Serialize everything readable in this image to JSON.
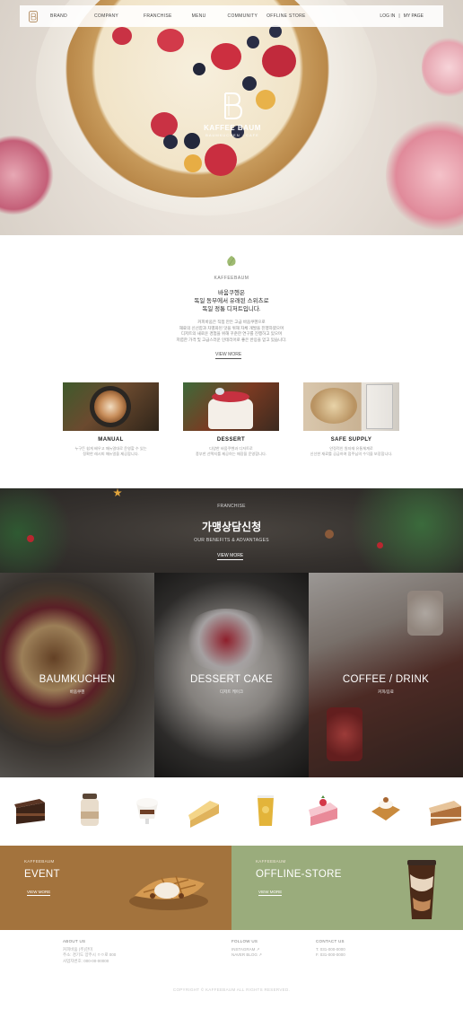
{
  "nav": {
    "items": [
      "BRAND",
      "COMPANY",
      "FRANCHISE",
      "MENU",
      "COMMUNITY",
      "OFFLINE STORE"
    ],
    "login": "LOG IN",
    "separator": "|",
    "mypage": "MY PAGE"
  },
  "hero": {
    "logo_name": "KAFFEE BAUM",
    "logo_sub": "BAUMKUCHEN · CAFE"
  },
  "about": {
    "brand": "KAFFEEBAUM",
    "headline": [
      "바움쿠헨은",
      "독일 동부에서 유래된 스위츠로",
      "독일 정통 디저트입니다."
    ],
    "desc": [
      "커피바움은 직접 만든 고급 바움쿠헨으로",
      "재료의 신선함과 차별화된 맛을 위해 자체 개발을 진행하였으며",
      "디저트의 새로운 경험을 위해 꾸준한 연구를 진행하고 있으며",
      "저렴한 가격 및 고급스러운 인테리어로 좋은 반응을 얻고 있습니다."
    ],
    "more": "VIEW MORE"
  },
  "cards": [
    {
      "title": "MANUAL",
      "text": [
        "누구든 쉽게 배우고 매뉴얼대로 운영할 수 있는",
        "정확한 레시피 매뉴얼을 제공합니다."
      ]
    },
    {
      "title": "DESSERT",
      "text": [
        "다양한 바움쿠헨과 디저트로",
        "풍부한 선택지를 제공하는 매장을 운영합니다."
      ]
    },
    {
      "title": "SAFE SUPPLY",
      "text": [
        "안정적인 원자재 유통체계로",
        "신선한 재료를 공급하여 점주님의 수익을 보장합니다."
      ]
    }
  ],
  "franchise": {
    "label": "FRANCHISE",
    "title": "가맹상담신청",
    "sub": "OUR BENEFITS & ADVANTAGES",
    "more": "VIEW MORE"
  },
  "panels": [
    {
      "title": "BAUMKUCHEN",
      "sub": "바움쿠헨"
    },
    {
      "title": "DESSERT CAKE",
      "sub": "디저트 케이크"
    },
    {
      "title": "COFFEE / DRINK",
      "sub": "커피/음료"
    }
  ],
  "promos": [
    {
      "kicker": "KAFFEEBAUM",
      "title": "EVENT",
      "more": "VIEW MORE",
      "color": "#a3733d"
    },
    {
      "kicker": "KAFFEEBAUM",
      "title": "OFFLINE-STORE",
      "more": "VIEW MORE",
      "color": "#9aac7c"
    }
  ],
  "footer": {
    "about": {
      "heading": "ABOUT US",
      "lines": [
        "커피바움 (주)한미",
        "주소: 경기도 양주시 ㅇㅇ로 000",
        "사업자번호: 000-00-00000"
      ]
    },
    "follow": {
      "heading": "FOLLOW US",
      "lines": [
        "INSTAGRAM ↗",
        "NAVER BLOG ↗"
      ]
    },
    "contact": {
      "heading": "CONTACT US",
      "lines": [
        "T. 031-000-0000",
        "F. 031-000-0000"
      ]
    },
    "copyright": "COPYRIGHT © KAFFEEBAUM ALL RIGHTS RESERVED."
  }
}
